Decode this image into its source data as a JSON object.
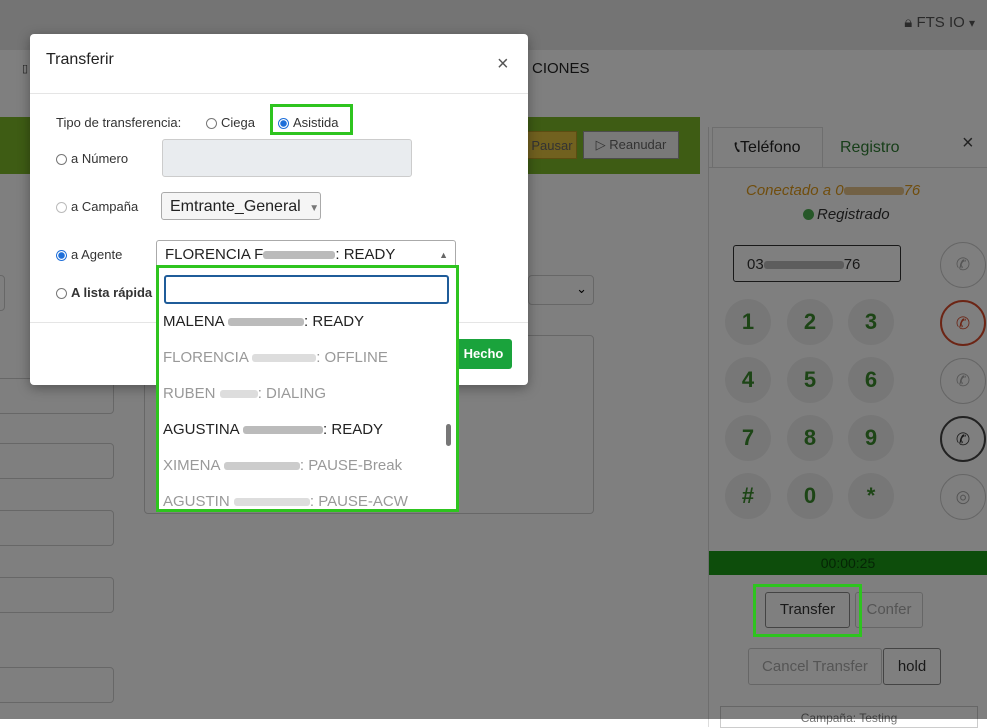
{
  "app": {
    "user_menu": "FTS IO",
    "user_caret": "▾",
    "nav_item": "CIONES",
    "btn_pausar": "Pausar",
    "btn_reanudar": "Reanudar"
  },
  "phone": {
    "tab_phone": "Teléfono",
    "tab_register": "Registro",
    "close": "×",
    "connected_prefix": "Conectado a 0",
    "connected_suffix": "76",
    "registered": "Registrado",
    "number_prefix": "03",
    "number_suffix": "76",
    "keypad": [
      "1",
      "2",
      "3",
      "4",
      "5",
      "6",
      "7",
      "8",
      "9",
      "#",
      "0",
      "*"
    ],
    "timer": "00:00:25",
    "btn_transfer": "Transfer",
    "btn_confer": "Confer",
    "btn_cancel_transfer": "Cancel Transfer",
    "btn_hold": "hold",
    "campaign_footer": "Campaña: Testing"
  },
  "modal": {
    "title": "Transferir",
    "close": "×",
    "transfer_type_label": "Tipo de transferencia:",
    "opt_ciega": "Ciega",
    "opt_asistida": "Asistida",
    "to_number": "a Número",
    "to_campaign": "a Campaña",
    "campaign_value": "Emtrante_General",
    "to_agent": "a Agente",
    "to_quick_list": "A lista rápida",
    "agent_selected_prefix": "FLORENCIA F",
    "agent_selected_suffix": ": READY",
    "btn_done": "Hecho",
    "agent_options": [
      {
        "first": "MALENA",
        "status": ": READY",
        "available": true
      },
      {
        "first": "FLORENCIA",
        "status": ": OFFLINE",
        "available": false
      },
      {
        "first": "RUBEN",
        "status": ": DIALING",
        "available": false
      },
      {
        "first": "AGUSTINA",
        "status": ": READY",
        "available": true
      },
      {
        "first": "XIMENA",
        "status": ": PAUSE-Break",
        "available": false
      },
      {
        "first": "AGUSTIN",
        "status": ": PAUSE-ACW",
        "available": false
      }
    ]
  },
  "colors": {
    "highlight": "#2ec41f",
    "strip_green": "#7cb928",
    "timer_green": "#1a9a17",
    "done_button": "#1aa33c"
  }
}
